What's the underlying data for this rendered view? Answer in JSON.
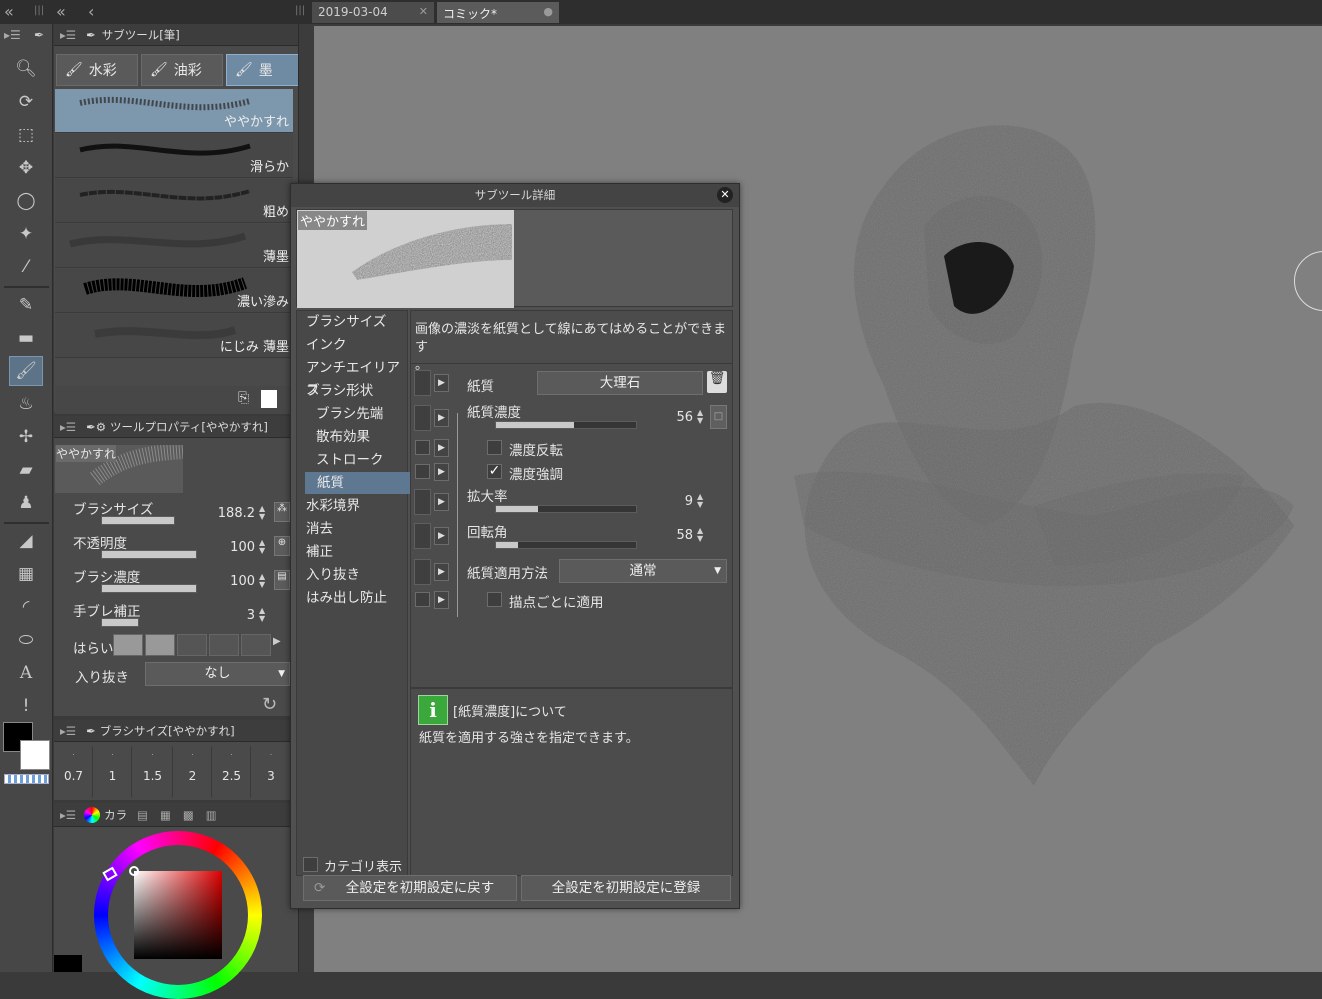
{
  "tabs": [
    "2019-03-04",
    "コミック*"
  ],
  "subtool_panel": {
    "title": "サブツール[筆]",
    "brush_tabs": [
      "水彩",
      "油彩",
      "墨"
    ],
    "brushes": [
      "ややかすれ",
      "滑らか",
      "粗め",
      "薄墨",
      "濃い滲み",
      "にじみ 薄墨"
    ]
  },
  "tool_property": {
    "title": "ツールプロパティ[ややかすれ]",
    "preview_label": "ややかすれ",
    "props": [
      {
        "label": "ブラシサイズ",
        "value": "188.2",
        "fill": 0.75
      },
      {
        "label": "不透明度",
        "value": "100",
        "fill": 1.0
      },
      {
        "label": "ブラシ濃度",
        "value": "100",
        "fill": 1.0
      },
      {
        "label": "手ブレ補正",
        "value": "3",
        "fill": 0.4
      }
    ],
    "harai_label": "はらい",
    "iri_label": "入り抜き",
    "iri_value": "なし"
  },
  "brush_size_panel": {
    "title": "ブラシサイズ[ややかすれ]",
    "sizes": [
      "0.7",
      "1",
      "1.5",
      "2",
      "2.5",
      "3"
    ]
  },
  "color_panel": {
    "tab_label": "カラ"
  },
  "dialog": {
    "title": "サブツール詳細",
    "preview_label": "ややかすれ",
    "categories": [
      "ブラシサイズ",
      "インク",
      "アンチエイリアス",
      "ブラシ形状",
      "ブラシ先端",
      "散布効果",
      "ストローク",
      "紙質",
      "水彩境界",
      "消去",
      "補正",
      "入り抜き",
      "はみ出し防止"
    ],
    "selected_category": "紙質",
    "description_line1": "画像の濃淡を紙質として線にあてはめることができます",
    "description_line2": "。",
    "settings": {
      "paper_label": "紙質",
      "paper_value": "大理石",
      "density_label": "紙質濃度",
      "density_value": "56",
      "density_fill": 0.56,
      "invert_label": "濃度反転",
      "invert_checked": false,
      "emphasize_label": "濃度強調",
      "emphasize_checked": true,
      "scale_label": "拡大率",
      "scale_value": "9",
      "scale_fill": 0.3,
      "rotation_label": "回転角",
      "rotation_value": "58",
      "rotation_fill": 0.16,
      "method_label": "紙質適用方法",
      "method_value": "通常",
      "perpoint_label": "描点ごとに適用",
      "perpoint_checked": false
    },
    "help_title": "[紙質濃度]について",
    "help_text": "紙質を適用する強さを指定できます。",
    "category_display_label": "カテゴリ表示",
    "reset_button": "全設定を初期設定に戻す",
    "register_button": "全設定を初期設定に登録"
  },
  "colors": {
    "accent": "#6f8aa3",
    "selected_item": "#7d97ad",
    "panel_bg": "#4a4a4a",
    "canvas_bg": "#808080",
    "help_icon": "#3aa83a"
  }
}
